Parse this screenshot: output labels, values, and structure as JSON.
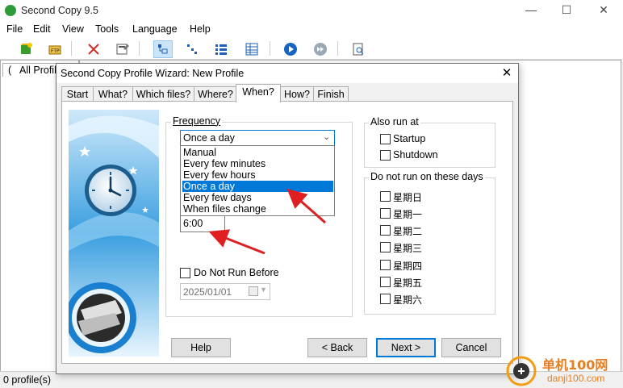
{
  "app": {
    "title": "Second Copy 9.5",
    "window_controls": [
      "minimize-icon",
      "maximize-icon",
      "close-icon"
    ]
  },
  "menu": [
    "File",
    "Edit",
    "View",
    "Tools",
    "Language",
    "Help"
  ],
  "toolbar_icons": [
    "new-profile-icon",
    "ftp-icon",
    "delete-icon",
    "properties-icon",
    "view-icon-1",
    "view-icon-2",
    "view-icon-3",
    "view-icon-4",
    "run-icon",
    "skip-icon",
    "report-icon"
  ],
  "profiles_tab": "All Profile",
  "status": "0 profile(s)",
  "dialog": {
    "title": "Second Copy Profile Wizard: New Profile",
    "tabs": [
      "Start",
      "What?",
      "Which files?",
      "Where?",
      "When?",
      "How?",
      "Finish"
    ],
    "selected_tab": "When?",
    "frequency": {
      "legend": "Frequency",
      "value": "Once a day",
      "options": [
        "Manual",
        "Every few minutes",
        "Every few hours",
        "Once a day",
        "Every few days",
        "When files change"
      ],
      "time": "6:00"
    },
    "do_not_run_before": {
      "label": "Do Not Run Before",
      "date": "2025/01/01"
    },
    "also_run_at": {
      "legend": "Also run at",
      "options": [
        "Startup",
        "Shutdown"
      ]
    },
    "do_not_run_days": {
      "legend": "Do not run on these days",
      "days": [
        "星期日",
        "星期一",
        "星期二",
        "星期三",
        "星期四",
        "星期五",
        "星期六"
      ]
    },
    "buttons": {
      "help": "Help",
      "back": "< Back",
      "next": "Next >",
      "cancel": "Cancel"
    }
  },
  "watermark": {
    "site": "单机100网",
    "url": "danji100.com"
  }
}
